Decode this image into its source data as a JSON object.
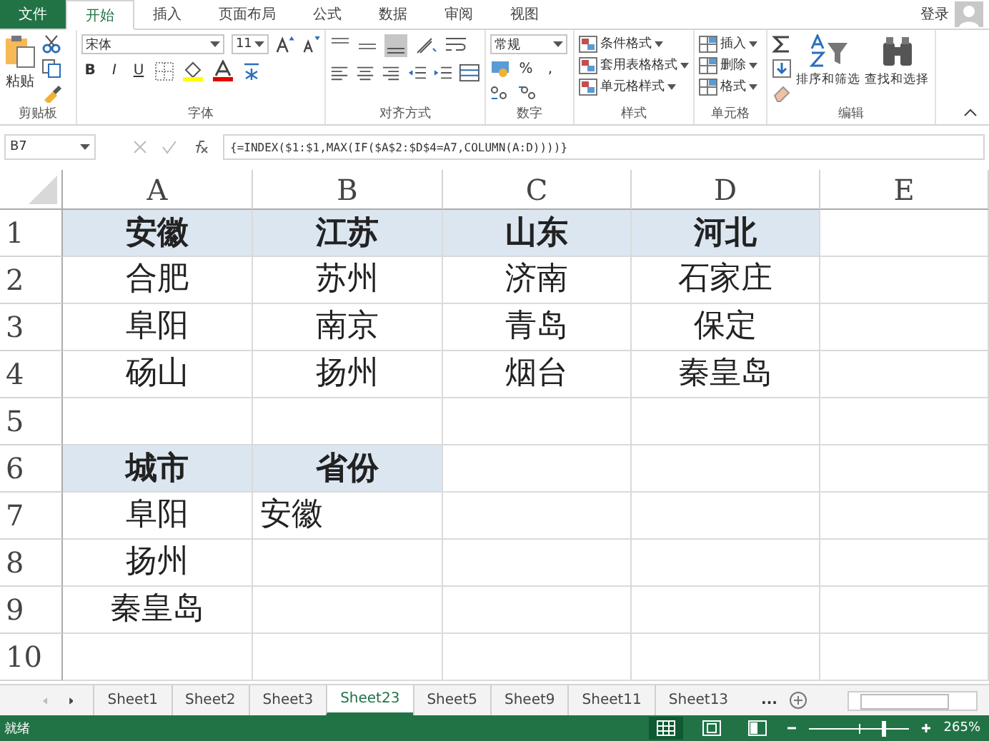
{
  "ribbon_tabs": [
    {
      "label": "文件",
      "kind": "file",
      "selected": false
    },
    {
      "label": "开始",
      "kind": "tab",
      "selected": true
    },
    {
      "label": "插入",
      "kind": "tab",
      "selected": false
    },
    {
      "label": "页面布局",
      "kind": "tab",
      "selected": false
    },
    {
      "label": "公式",
      "kind": "tab",
      "selected": false
    },
    {
      "label": "数据",
      "kind": "tab",
      "selected": false
    },
    {
      "label": "审阅",
      "kind": "tab",
      "selected": false
    },
    {
      "label": "视图",
      "kind": "tab",
      "selected": false
    }
  ],
  "account": {
    "label": "登录"
  },
  "ribbon": {
    "clipboard": {
      "paste": "粘贴",
      "group": "剪贴板"
    },
    "font": {
      "name": "宋体",
      "size": "11",
      "bold": "B",
      "italic": "I",
      "underline": "U",
      "group": "字体"
    },
    "alignment": {
      "group": "对齐方式"
    },
    "number": {
      "format": "常规",
      "percent": "%",
      "comma": ",",
      "group": "数字"
    },
    "styles": {
      "items": [
        "条件格式",
        "套用表格格式",
        "单元格样式"
      ],
      "group": "样式"
    },
    "cells": {
      "items": [
        "插入",
        "删除",
        "格式"
      ],
      "group": "单元格"
    },
    "editing": {
      "items": [
        "排序和筛选",
        "查找和选择"
      ],
      "group": "编辑"
    }
  },
  "formula_bar": {
    "name_box": "B7",
    "formula": "{=INDEX($1:$1,MAX(IF($A$2:$D$4=A7,COLUMN(A:D))))}"
  },
  "sheet": {
    "columns": [
      "A",
      "B",
      "C",
      "D",
      "E"
    ],
    "rows": [
      {
        "header": "1",
        "cells": [
          {
            "text": "安徽",
            "bold": true,
            "highlighted": true,
            "left_aligned": false
          },
          {
            "text": "江苏",
            "bold": true,
            "highlighted": true,
            "left_aligned": false
          },
          {
            "text": "山东",
            "bold": true,
            "highlighted": true,
            "left_aligned": false
          },
          {
            "text": "河北",
            "bold": true,
            "highlighted": true,
            "left_aligned": false
          }
        ]
      },
      {
        "header": "2",
        "cells": [
          {
            "text": "合肥",
            "bold": false,
            "highlighted": false,
            "left_aligned": false
          },
          {
            "text": "苏州",
            "bold": false,
            "highlighted": false,
            "left_aligned": false
          },
          {
            "text": "济南",
            "bold": false,
            "highlighted": false,
            "left_aligned": false
          },
          {
            "text": "石家庄",
            "bold": false,
            "highlighted": false,
            "left_aligned": false
          }
        ]
      },
      {
        "header": "3",
        "cells": [
          {
            "text": "阜阳",
            "bold": false,
            "highlighted": false,
            "left_aligned": false
          },
          {
            "text": "南京",
            "bold": false,
            "highlighted": false,
            "left_aligned": false
          },
          {
            "text": "青岛",
            "bold": false,
            "highlighted": false,
            "left_aligned": false
          },
          {
            "text": "保定",
            "bold": false,
            "highlighted": false,
            "left_aligned": false
          }
        ]
      },
      {
        "header": "4",
        "cells": [
          {
            "text": "砀山",
            "bold": false,
            "highlighted": false,
            "left_aligned": false
          },
          {
            "text": "扬州",
            "bold": false,
            "highlighted": false,
            "left_aligned": false
          },
          {
            "text": "烟台",
            "bold": false,
            "highlighted": false,
            "left_aligned": false
          },
          {
            "text": "秦皇岛",
            "bold": false,
            "highlighted": false,
            "left_aligned": false
          }
        ]
      },
      {
        "header": "5",
        "cells": []
      },
      {
        "header": "6",
        "cells": [
          {
            "text": "城市",
            "bold": true,
            "highlighted": true,
            "left_aligned": false
          },
          {
            "text": "省份",
            "bold": true,
            "highlighted": true,
            "left_aligned": false
          }
        ]
      },
      {
        "header": "7",
        "cells": [
          {
            "text": "阜阳",
            "bold": false,
            "highlighted": false,
            "left_aligned": false
          },
          {
            "text": "安徽",
            "bold": false,
            "highlighted": false,
            "left_aligned": true
          }
        ]
      },
      {
        "header": "8",
        "cells": [
          {
            "text": "扬州",
            "bold": false,
            "highlighted": false,
            "left_aligned": false
          }
        ]
      },
      {
        "header": "9",
        "cells": [
          {
            "text": "秦皇岛",
            "bold": false,
            "highlighted": false,
            "left_aligned": false
          }
        ]
      },
      {
        "header": "10",
        "cells": []
      }
    ]
  },
  "sheet_tabs": {
    "tabs": [
      {
        "label": "Sheet1",
        "selected": false
      },
      {
        "label": "Sheet2",
        "selected": false
      },
      {
        "label": "Sheet3",
        "selected": false
      },
      {
        "label": "Sheet23",
        "selected": true
      },
      {
        "label": "Sheet5",
        "selected": false
      },
      {
        "label": "Sheet9",
        "selected": false
      },
      {
        "label": "Sheet11",
        "selected": false
      },
      {
        "label": "Sheet13",
        "selected": false
      }
    ],
    "more": "..."
  },
  "status_bar": {
    "status": "就绪",
    "zoom": {
      "level": 0.75,
      "reading": "265%"
    }
  }
}
